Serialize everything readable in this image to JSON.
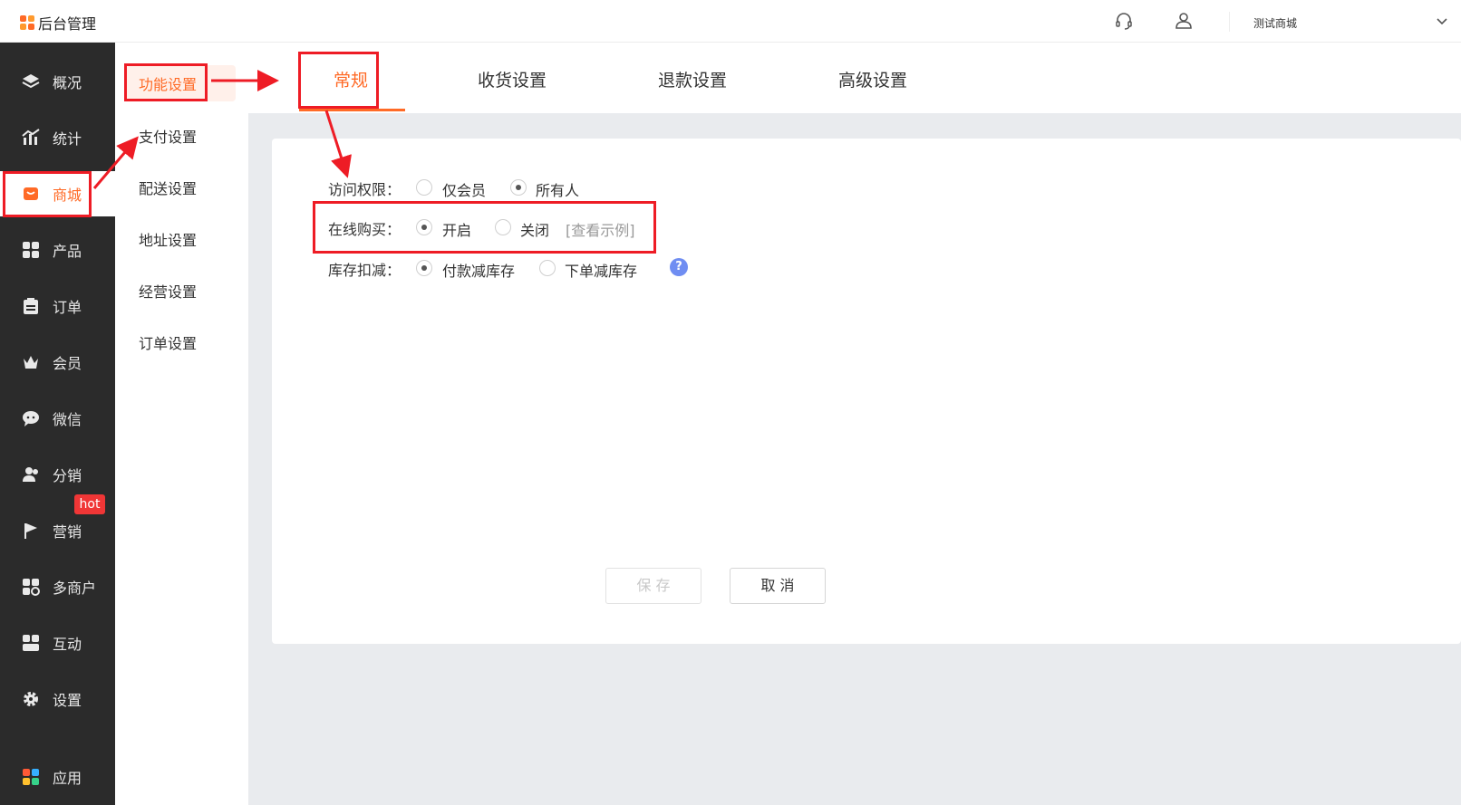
{
  "header": {
    "logo_text": "后台管理",
    "store_name": "测试商城",
    "support_icon": "headset-icon",
    "user_icon": "user-icon",
    "dropdown_icon": "chevron-down-icon"
  },
  "sidebar": {
    "items": [
      {
        "label": "概况",
        "icon": "layers-icon"
      },
      {
        "label": "统计",
        "icon": "chart-icon"
      },
      {
        "label": "商城",
        "icon": "shop-icon",
        "active": true
      },
      {
        "label": "产品",
        "icon": "grid-icon"
      },
      {
        "label": "订单",
        "icon": "clipboard-icon"
      },
      {
        "label": "会员",
        "icon": "crown-icon"
      },
      {
        "label": "微信",
        "icon": "chat-icon"
      },
      {
        "label": "分销",
        "icon": "users-icon"
      },
      {
        "label": "营销",
        "icon": "flag-icon"
      },
      {
        "label": "多商户",
        "icon": "merchants-icon"
      },
      {
        "label": "互动",
        "icon": "interact-icon"
      },
      {
        "label": "设置",
        "icon": "gear-icon"
      },
      {
        "label": "应用",
        "icon": "apps-icon"
      }
    ],
    "hot_badge": "hot"
  },
  "submenu": {
    "items": [
      "功能设置",
      "支付设置",
      "配送设置",
      "地址设置",
      "经营设置",
      "订单设置"
    ],
    "active": "功能设置"
  },
  "tabs": [
    "常规",
    "收货设置",
    "退款设置",
    "高级设置"
  ],
  "active_tab": "常规",
  "form": {
    "access": {
      "label": "访问权限：",
      "options": [
        "仅会员",
        "所有人"
      ],
      "selected": "所有人"
    },
    "online_purchase": {
      "label": "在线购买：",
      "options": [
        "开启",
        "关闭"
      ],
      "selected": "开启",
      "example_link": "[查看示例]"
    },
    "stock_deduction": {
      "label": "库存扣减：",
      "options": [
        "付款减库存",
        "下单减库存"
      ],
      "selected": "付款减库存",
      "help_icon": "question-icon",
      "help_text": "?"
    }
  },
  "buttons": {
    "save": "保 存",
    "cancel": "取 消"
  },
  "colors": {
    "accent": "#ff6a26",
    "sidebar_bg": "#2b2b2b",
    "annotation": "#ee1c25",
    "hot_badge": "#f03636"
  }
}
